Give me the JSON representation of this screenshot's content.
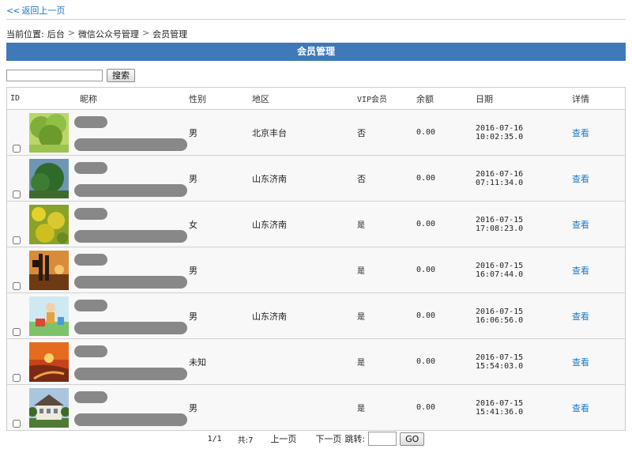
{
  "nav": {
    "back_icon": "double-chevron-left-icon",
    "back_label": "返回上一页"
  },
  "breadcrumb": {
    "prefix": "当前位置:",
    "items": [
      "后台",
      "微信公众号管理",
      "会员管理"
    ],
    "separator": ">"
  },
  "title": "会员管理",
  "search": {
    "value": "",
    "button": "搜索"
  },
  "table": {
    "headers": {
      "id": "ID",
      "nick": "昵称",
      "gender": "性别",
      "region": "地区",
      "vip": "VIP会员",
      "balance": "余额",
      "date": "日期",
      "detail": "详情"
    },
    "rows": [
      {
        "gender": "男",
        "region": "北京丰台",
        "vip": "否",
        "balance": "0.00",
        "date": "2016-07-16 10:02:35.0",
        "detail": "查看",
        "avatar": "green-tree"
      },
      {
        "gender": "男",
        "region": "山东济南",
        "vip": "否",
        "balance": "0.00",
        "date": "2016-07-16 07:11:34.0",
        "detail": "查看",
        "avatar": "tree-sky"
      },
      {
        "gender": "女",
        "region": "山东济南",
        "vip": "是",
        "balance": "0.00",
        "date": "2016-07-15 17:08:23.0",
        "detail": "查看",
        "avatar": "yellow-flowers"
      },
      {
        "gender": "男",
        "region": "",
        "vip": "是",
        "balance": "0.00",
        "date": "2016-07-15 16:07:44.0",
        "detail": "查看",
        "avatar": "sunset-walk"
      },
      {
        "gender": "男",
        "region": "山东济南",
        "vip": "是",
        "balance": "0.00",
        "date": "2016-07-15 16:06:56.0",
        "detail": "查看",
        "avatar": "cartoon"
      },
      {
        "gender": "未知",
        "region": "",
        "vip": "是",
        "balance": "0.00",
        "date": "2016-07-15 15:54:03.0",
        "detail": "查看",
        "avatar": "orange-sunset"
      },
      {
        "gender": "男",
        "region": "",
        "vip": "是",
        "balance": "0.00",
        "date": "2016-07-15 15:41:36.0",
        "detail": "查看",
        "avatar": "house"
      }
    ]
  },
  "pager": {
    "page": "1/1",
    "total": "共:7",
    "prev": "上一页",
    "next": "下一页",
    "jump_label": "跳转:",
    "go": "GO",
    "jump_value": ""
  },
  "colors": {
    "accent": "#3f79b9",
    "link": "#1b7ac9",
    "vip_yes": "#e62323"
  }
}
